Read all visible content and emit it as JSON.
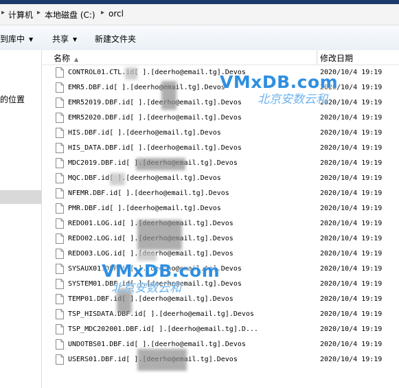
{
  "address": {
    "crumbs": [
      "计算机",
      "本地磁盘 (C:)",
      "orcl"
    ],
    "separator": "▸"
  },
  "toolbar": {
    "library": "到库中",
    "share": "共享",
    "new_folder": "新建文件夹"
  },
  "nav": {
    "location": "的位置"
  },
  "columns": {
    "name": "名称",
    "date": "修改日期"
  },
  "files": [
    {
      "name": "CONTROL01.CTL.id[          ].[deerho@email.tg].Devos",
      "date": "2020/10/4 19:19"
    },
    {
      "name": "EMR5.DBF.id[       ].[deerho@email.tg].Devos",
      "date": "2020/10/4 19:19"
    },
    {
      "name": "EMR52019.DBF.id[       ].[deerho@email.tg].Devos",
      "date": "2020/10/4 19:19"
    },
    {
      "name": "EMR52020.DBF.id[       ].[deerho@email.tg].Devos",
      "date": "2020/10/4 19:19"
    },
    {
      "name": "HIS.DBF.id[       ].[deerho@email.tg].Devos",
      "date": "2020/10/4 19:19"
    },
    {
      "name": "HIS_DATA.DBF.id[       ].[deerho@email.tg].Devos",
      "date": "2020/10/4 19:19"
    },
    {
      "name": "MDC2019.DBF.id[       ].[deerho@email.tg].Devos",
      "date": "2020/10/4 19:19"
    },
    {
      "name": "MQC.DBF.id[       ].[deerho@email.tg].Devos",
      "date": "2020/10/4 19:19"
    },
    {
      "name": "NFEMR.DBF.id[       ].[deerho@email.tg].Devos",
      "date": "2020/10/4 19:19"
    },
    {
      "name": "PMR.DBF.id[       ].[deerho@email.tg].Devos",
      "date": "2020/10/4 19:19"
    },
    {
      "name": "REDO01.LOG.id[       ].[deerho@email.tg].Devos",
      "date": "2020/10/4 19:19"
    },
    {
      "name": "REDO02.LOG.id[       ].[deerho@email.tg].Devos",
      "date": "2020/10/4 19:19"
    },
    {
      "name": "REDO03.LOG.id[       ].[deerho@email.tg].Devos",
      "date": "2020/10/4 19:19"
    },
    {
      "name": "SYSAUX01.DBF.id[       ].[deerho@email.tg].Devos",
      "date": "2020/10/4 19:19"
    },
    {
      "name": "SYSTEM01.DBF.id[       ].[deerho@email.tg].Devos",
      "date": "2020/10/4 19:19"
    },
    {
      "name": "TEMP01.DBF.id[       ].[deerho@email.tg].Devos",
      "date": "2020/10/4 19:19"
    },
    {
      "name": "TSP_HISDATA.DBF.id[       ].[deerho@email.tg].Devos",
      "date": "2020/10/4 19:19"
    },
    {
      "name": "TSP_MDC202001.DBF.id[       ].[deerho@email.tg].D...",
      "date": "2020/10/4 19:19"
    },
    {
      "name": "UNDOTBS01.DBF.id[       ].[deerho@email.tg].Devos",
      "date": "2020/10/4 19:19"
    },
    {
      "name": "USERS01.DBF.id[       ].[deerho@email.tg].Devos",
      "date": "2020/10/4 19:19"
    }
  ],
  "watermarks": [
    {
      "brand": "VMxDB.com",
      "subtitle": "北京安数云和"
    },
    {
      "brand": "VMxDB.com",
      "subtitle": "北京安数云和"
    }
  ]
}
